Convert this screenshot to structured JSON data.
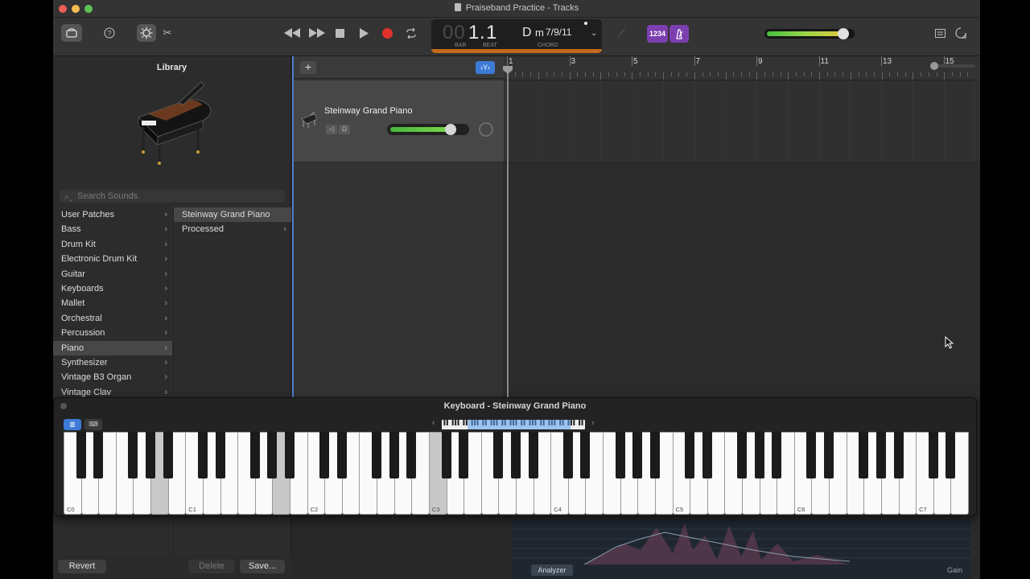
{
  "window": {
    "title": "Praiseband Practice - Tracks"
  },
  "toolbar": {
    "lcd": {
      "bar": "1",
      "beat": "1",
      "bar_prefix": "00",
      "bar_label": "BAR",
      "beat_label": "BEAT",
      "chord_root": "D",
      "chord_quality": "m",
      "chord_ext": "7/9/11",
      "chord_label": "CHORD"
    },
    "count_in_label": "1234",
    "master_volume_fraction": 0.9
  },
  "library": {
    "title": "Library",
    "search_placeholder": "Search Sounds",
    "categories": [
      "User Patches",
      "Bass",
      "Drum Kit",
      "Electronic Drum Kit",
      "Guitar",
      "Keyboards",
      "Mallet",
      "Orchestral",
      "Percussion",
      "Piano",
      "Synthesizer",
      "Vintage B3 Organ",
      "Vintage Clav"
    ],
    "selected_category": "Piano",
    "patches": [
      "Steinway Grand Piano",
      "Processed"
    ],
    "selected_patch": "Steinway Grand Piano",
    "revert_label": "Revert",
    "delete_label": "Delete",
    "save_label": "Save..."
  },
  "track": {
    "name": "Steinway Grand Piano",
    "volume_fraction": 0.8
  },
  "ruler": {
    "bars": [
      "1",
      "3",
      "5",
      "7",
      "9",
      "11",
      "13",
      "15"
    ]
  },
  "keyboard": {
    "title": "Keyboard - Steinway Grand Piano",
    "octave_labels": [
      "C0",
      "C1",
      "C2",
      "C3",
      "C4",
      "C5",
      "C6",
      "C7"
    ]
  },
  "analyzer": {
    "button_label": "Analyzer",
    "gain_label": "Gain"
  },
  "colors": {
    "accent": "#3d7ad6",
    "lcd_strip": "#c46a1b",
    "purple": "#7b3fb0",
    "record": "#e0312b"
  }
}
